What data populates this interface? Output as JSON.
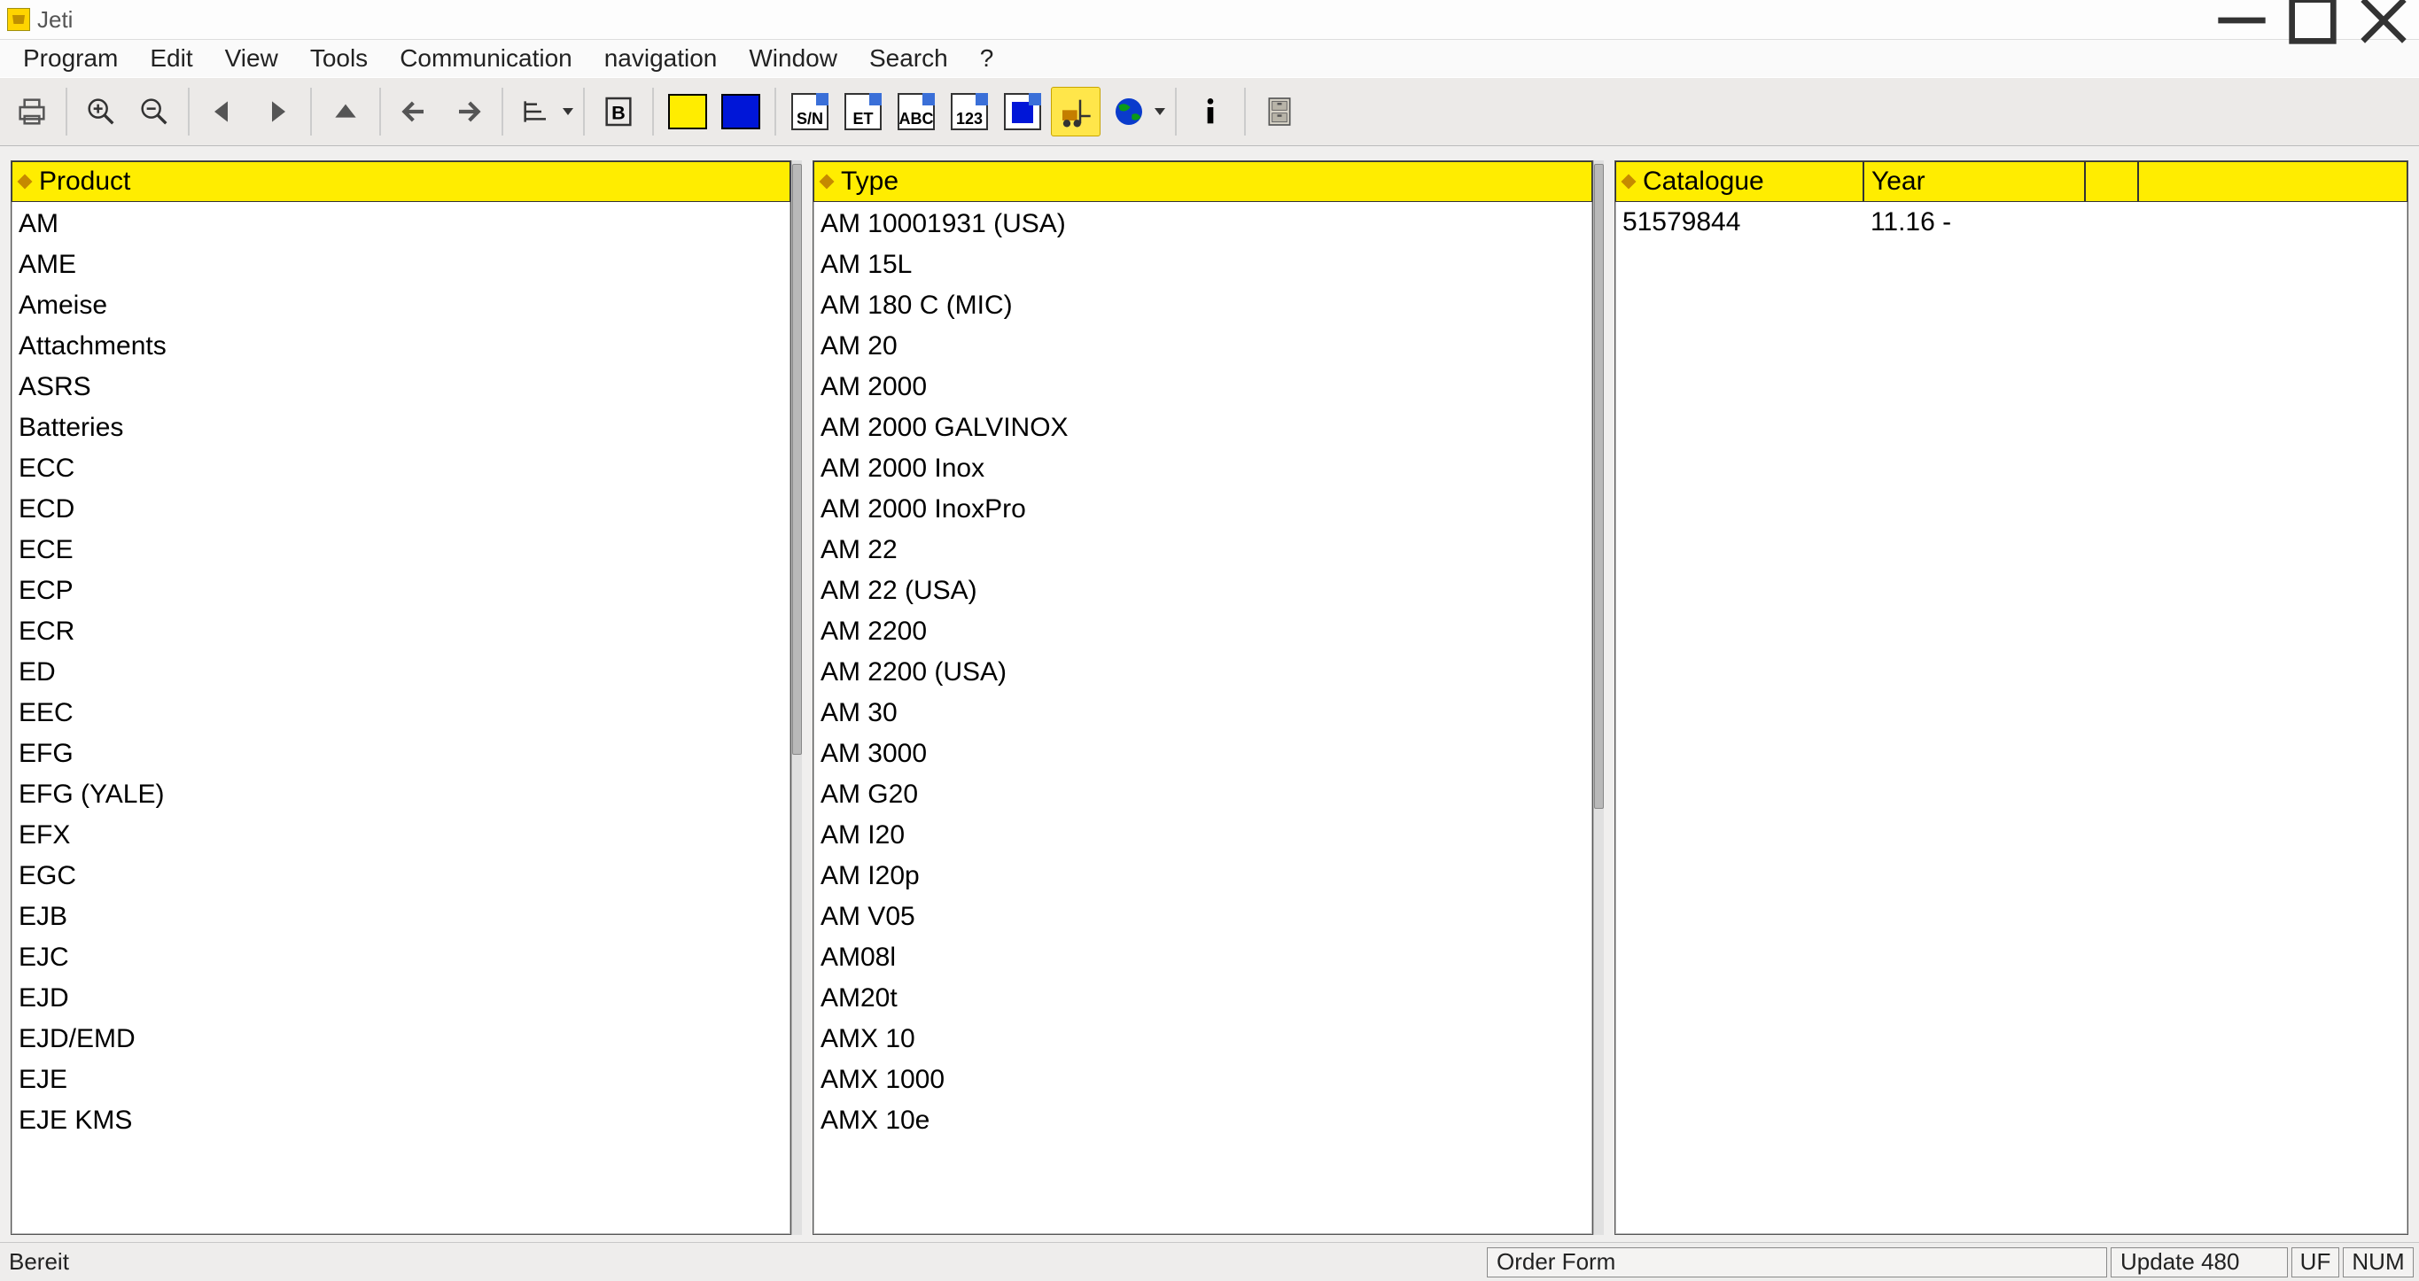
{
  "title": "Jeti",
  "menu": [
    "Program",
    "Edit",
    "View",
    "Tools",
    "Communication",
    "navigation",
    "Window",
    "Search",
    "?"
  ],
  "toolbar": {
    "swatch1": "#ffed00",
    "swatch2": "#0016d8",
    "boxlabels": [
      "S/N",
      "ET",
      "ABC",
      "123"
    ]
  },
  "headers": {
    "product": "Product",
    "type": "Type",
    "catalogue": "Catalogue",
    "year": "Year"
  },
  "products": [
    "AM",
    "AME",
    "Ameise",
    "Attachments",
    "ASRS",
    "Batteries",
    "ECC",
    "ECD",
    "ECE",
    "ECP",
    "ECR",
    "ED",
    "EEC",
    "EFG",
    "EFG (YALE)",
    "EFX",
    "EGC",
    "EJB",
    "EJC",
    "EJD",
    "EJD/EMD",
    "EJE",
    "EJE KMS"
  ],
  "types": [
    "AM 10001931 (USA)",
    "AM 15L",
    "AM 180 C (MIC)",
    "AM 20",
    "AM 2000",
    "AM 2000 GALVINOX",
    "AM 2000 Inox",
    "AM 2000 InoxPro",
    "AM 22",
    "AM 22 (USA)",
    "AM 2200",
    "AM 2200 (USA)",
    "AM 30",
    "AM 3000",
    "AM G20",
    "AM I20",
    "AM I20p",
    "AM V05",
    "AM08l",
    "AM20t",
    "AMX 10",
    "AMX 1000",
    "AMX 10e"
  ],
  "catalogue_cols": {
    "c1": 280,
    "c2": 250,
    "c3": 60,
    "c4": 240
  },
  "catalogue_rows": [
    {
      "catalogue": "51579844",
      "year": "11.16 -",
      "c3": "",
      "c4": ""
    }
  ],
  "status": {
    "ready": "Bereit",
    "order_form": "Order Form",
    "update": "Update 480",
    "flags": [
      "UF",
      "NUM"
    ]
  }
}
